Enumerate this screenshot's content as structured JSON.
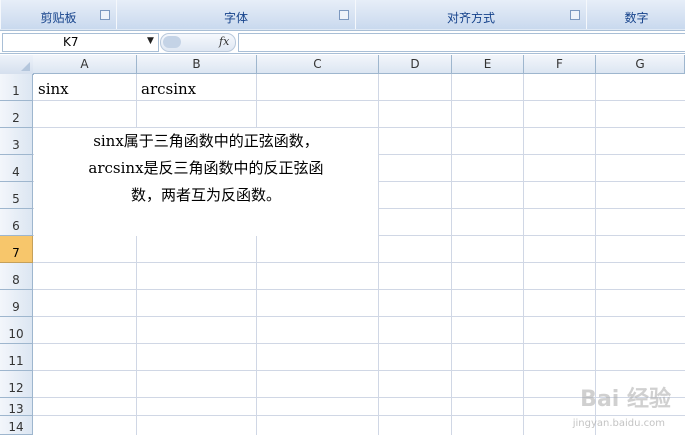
{
  "ribbon": {
    "groups": [
      "剪贴板",
      "字体",
      "对齐方式",
      "数字"
    ]
  },
  "formula_bar": {
    "name_box": "K7",
    "fx_label": "fx",
    "formula": ""
  },
  "columns": [
    "A",
    "B",
    "C",
    "D",
    "E",
    "F",
    "G"
  ],
  "rows": [
    "1",
    "2",
    "3",
    "4",
    "5",
    "6",
    "7",
    "8",
    "9",
    "10",
    "11",
    "12",
    "13",
    "14"
  ],
  "cells": {
    "A1": "sinx",
    "B1": "arcsinx"
  },
  "merged_text": {
    "line1": "sinx属于三角函数中的正弦函数，",
    "line2": "arcsinx是反三角函数中的反正弦函",
    "line3": "数，两者互为反函数。"
  },
  "watermark": {
    "logo": "Bai 经验",
    "url": "jingyan.baidu.com"
  }
}
